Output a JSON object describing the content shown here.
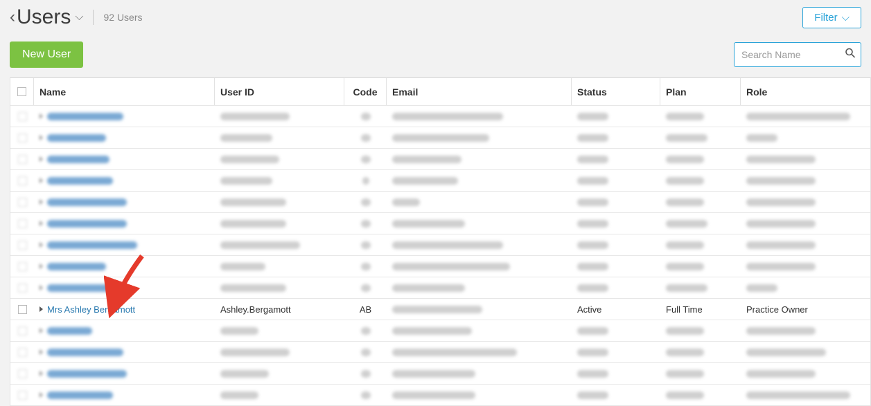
{
  "header": {
    "title": "Users",
    "count_text": "92 Users",
    "filter_label": "Filter"
  },
  "toolbar": {
    "new_user_label": "New User",
    "search_placeholder": "Search Name"
  },
  "columns": {
    "name": "Name",
    "user_id": "User ID",
    "code": "Code",
    "email": "Email",
    "status": "Status",
    "plan": "Plan",
    "role": "Role"
  },
  "blurred_rows_before": 9,
  "blurred_rows_after": 4,
  "focused_row": {
    "name": "Mrs Ashley Bergamott",
    "user_id": "Ashley.Bergamott",
    "code": "AB",
    "email": "",
    "status": "Active",
    "plan": "Full Time",
    "role": "Practice Owner"
  },
  "blur_widths": [
    [
      110,
      100,
      14,
      160,
      45,
      55,
      150
    ],
    [
      85,
      75,
      14,
      140,
      45,
      60,
      45
    ],
    [
      90,
      85,
      14,
      100,
      45,
      55,
      100
    ],
    [
      95,
      75,
      10,
      95,
      45,
      55,
      100
    ],
    [
      115,
      95,
      14,
      40,
      45,
      55,
      100
    ],
    [
      115,
      95,
      14,
      105,
      45,
      60,
      100
    ],
    [
      130,
      115,
      14,
      160,
      45,
      55,
      100
    ],
    [
      85,
      65,
      14,
      170,
      45,
      55,
      100
    ],
    [
      110,
      95,
      14,
      105,
      45,
      60,
      45
    ],
    [
      65,
      55,
      14,
      115,
      45,
      55,
      100
    ],
    [
      110,
      100,
      14,
      180,
      45,
      55,
      115
    ],
    [
      115,
      70,
      14,
      120,
      45,
      55,
      100
    ],
    [
      95,
      55,
      14,
      120,
      45,
      55,
      150
    ]
  ]
}
